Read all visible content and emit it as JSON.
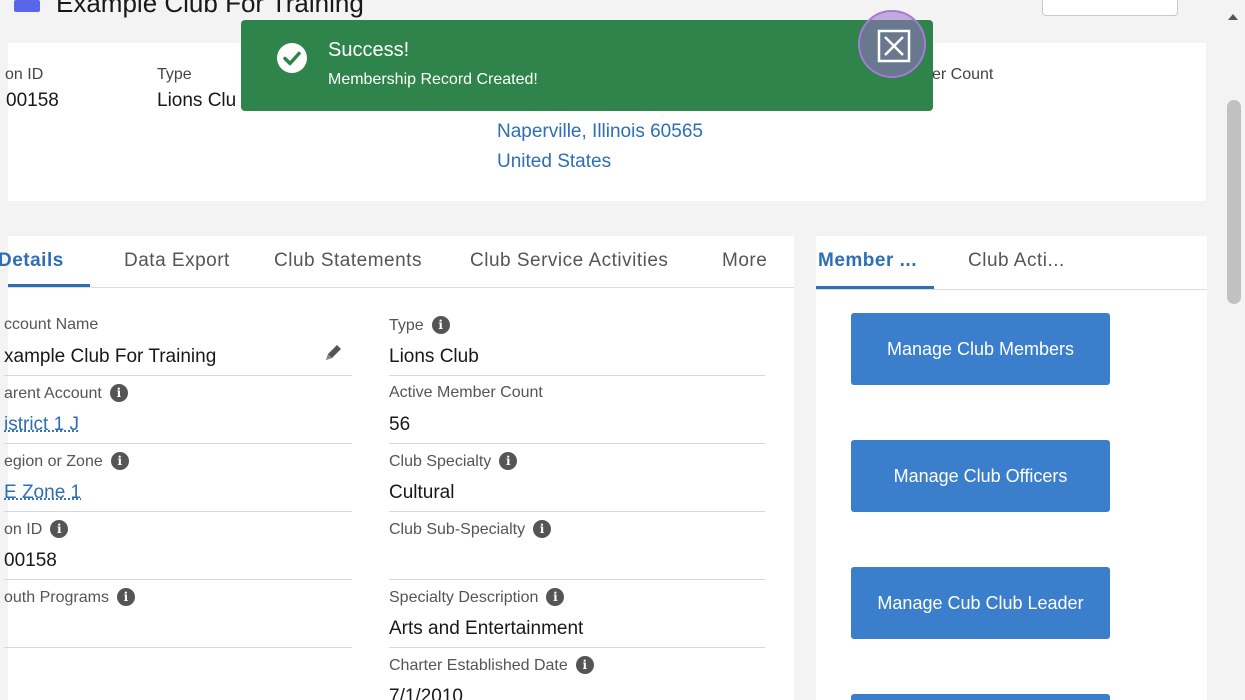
{
  "header": {
    "title": "Example Club For Training"
  },
  "highlights": {
    "id_label": "on ID",
    "id_value": "00158",
    "type_label": "Type",
    "type_value": "Lions Clu",
    "address_line2": "Naperville, Illinois 60565",
    "address_line3": "United States",
    "count_label": "er Count"
  },
  "toast": {
    "title": "Success!",
    "message": "Membership Record Created!"
  },
  "details": {
    "tabs": [
      {
        "label": "Details"
      },
      {
        "label": "Data Export"
      },
      {
        "label": "Club Statements"
      },
      {
        "label": "Club Service Activities"
      },
      {
        "label": "More"
      }
    ],
    "left_fields": [
      {
        "label": "ccount Name",
        "value": "xample Club For Training"
      },
      {
        "label": "arent Account",
        "value": "istrict 1 J"
      },
      {
        "label": "egion or Zone",
        "value": "E Zone 1"
      },
      {
        "label": "on ID",
        "value": "00158"
      },
      {
        "label": "outh Programs",
        "value": ""
      }
    ],
    "right_fields": [
      {
        "label": "Type",
        "value": "Lions Club"
      },
      {
        "label": "Active Member Count",
        "value": "56"
      },
      {
        "label": "Club Specialty",
        "value": "Cultural"
      },
      {
        "label": "Club Sub-Specialty",
        "value": ""
      },
      {
        "label": "Specialty Description",
        "value": "Arts and Entertainment"
      },
      {
        "label": "Charter Established Date",
        "value": "7/1/2010"
      }
    ]
  },
  "right_panel": {
    "tabs": [
      {
        "label": "Member ..."
      },
      {
        "label": "Club Acti..."
      }
    ],
    "buttons": [
      {
        "label": "Manage Club Members"
      },
      {
        "label": "Manage Club Officers"
      },
      {
        "label": "Manage Cub Club Leader"
      }
    ]
  },
  "colors": {
    "toast_bg": "#2e844a",
    "brand_blue": "#2e6eb5",
    "button_blue": "#3b7fcc"
  }
}
